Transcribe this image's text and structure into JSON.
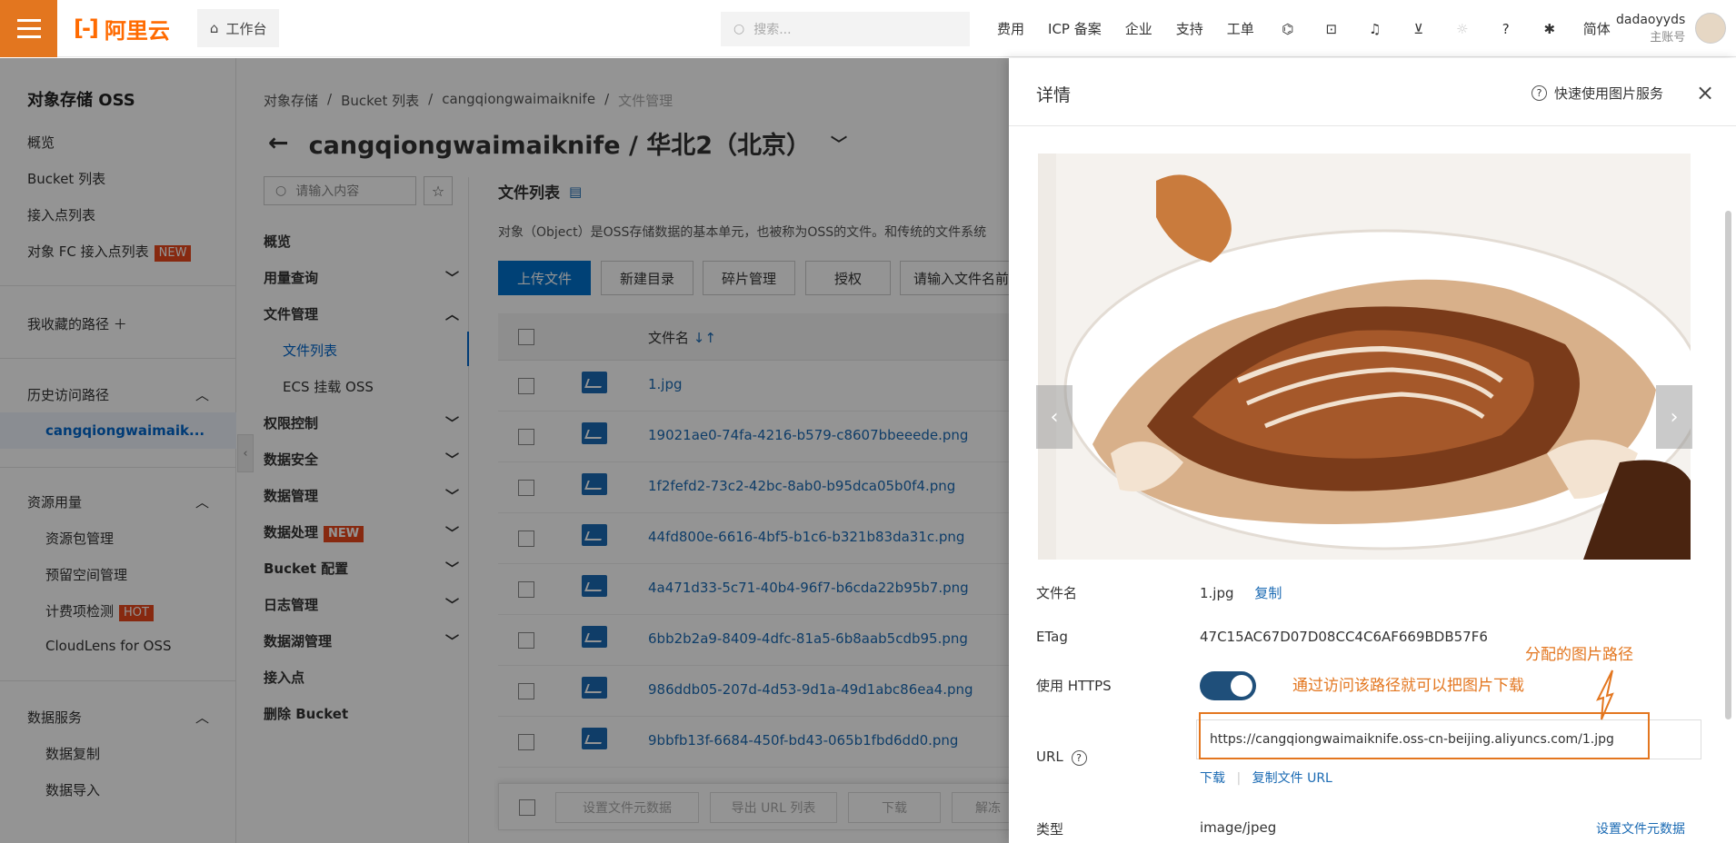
{
  "topbar": {
    "logo_text": "阿里云",
    "workbench": "工作台",
    "search_placeholder": "搜索...",
    "nav": [
      "费用",
      "ICP 备案",
      "企业",
      "支持",
      "工单"
    ],
    "lang": "简体",
    "user_name": "dadaoyyds",
    "user_role": "主账号"
  },
  "sidebar": {
    "title": "对象存储 OSS",
    "items": [
      "概览",
      "Bucket 列表",
      "接入点列表",
      "对象 FC 接入点列表"
    ],
    "fc_badge": "NEW",
    "favorites": "我收藏的路径",
    "history": "历史访问路径",
    "history_item": "cangqiongwaimaik...",
    "resource": "资源用量",
    "resource_items": [
      "资源包管理",
      "预留空间管理",
      "计费项检测",
      "CloudLens for OSS"
    ],
    "hot_badge": "HOT",
    "data_service": "数据服务",
    "data_service_items": [
      "数据复制",
      "数据导入"
    ]
  },
  "breadcrumb": [
    "对象存储",
    "Bucket 列表",
    "cangqiongwaimaiknife",
    "文件管理"
  ],
  "page_title": "cangqiongwaimaiknife / 华北2（北京）",
  "bucket_nav": {
    "search_placeholder": "请输入内容",
    "items": [
      "概览",
      "用量查询",
      "文件管理",
      "文件列表",
      "ECS 挂载 OSS",
      "权限控制",
      "数据安全",
      "数据管理",
      "数据处理",
      "Bucket 配置",
      "日志管理",
      "数据湖管理",
      "接入点",
      "删除 Bucket"
    ],
    "new_badge": "NEW"
  },
  "file_list": {
    "title": "文件列表",
    "desc": "对象（Object）是OSS存储数据的基本单元，也被称为OSS的文件。和传统的文件系统",
    "buttons": [
      "上传文件",
      "新建目录",
      "碎片管理",
      "授权",
      "请输入文件名前"
    ],
    "col_name": "文件名",
    "files": [
      "1.jpg",
      "19021ae0-74fa-4216-b579-c8607bbeeede.png",
      "1f2fefd2-73c2-42bc-8ab0-b95dca05b0f4.png",
      "44fd800e-6616-4bf5-b1c6-b321b83da31c.png",
      "4a471d33-5c71-40b4-96f7-b6cda22b95b7.png",
      "6bb2b2a9-8409-4dfc-81a5-6b8aab5cdb95.png",
      "986ddb05-207d-4d53-9d1a-49d1abc86ea4.png",
      "9bbfb13f-6684-450f-bd43-065b1fbd6dd0.png"
    ],
    "bottom_actions": [
      "设置文件元数据",
      "导出 URL 列表",
      "下载",
      "解冻"
    ]
  },
  "detail": {
    "title": "详情",
    "quick_link": "快速使用图片服务",
    "labels": {
      "filename": "文件名",
      "etag": "ETag",
      "https": "使用 HTTPS",
      "url": "URL",
      "type": "类型"
    },
    "filename": "1.jpg",
    "copy": "复制",
    "etag": "47C15AC67D07D08CC4C6AF669BDB57F6",
    "url": "https://cangqiongwaimaiknife.oss-cn-beijing.aliyuncs.com/1.jpg",
    "download": "下载",
    "copy_url": "复制文件 URL",
    "type": "image/jpeg",
    "set_meta": "设置文件元数据"
  },
  "annotations": {
    "path_label": "分配的图片路径",
    "path_hint": "通过访问该路径就可以把图片下载"
  },
  "colors": {
    "brand": "#e3761f",
    "primary": "#0070cc",
    "link": "#1a6ab3"
  }
}
